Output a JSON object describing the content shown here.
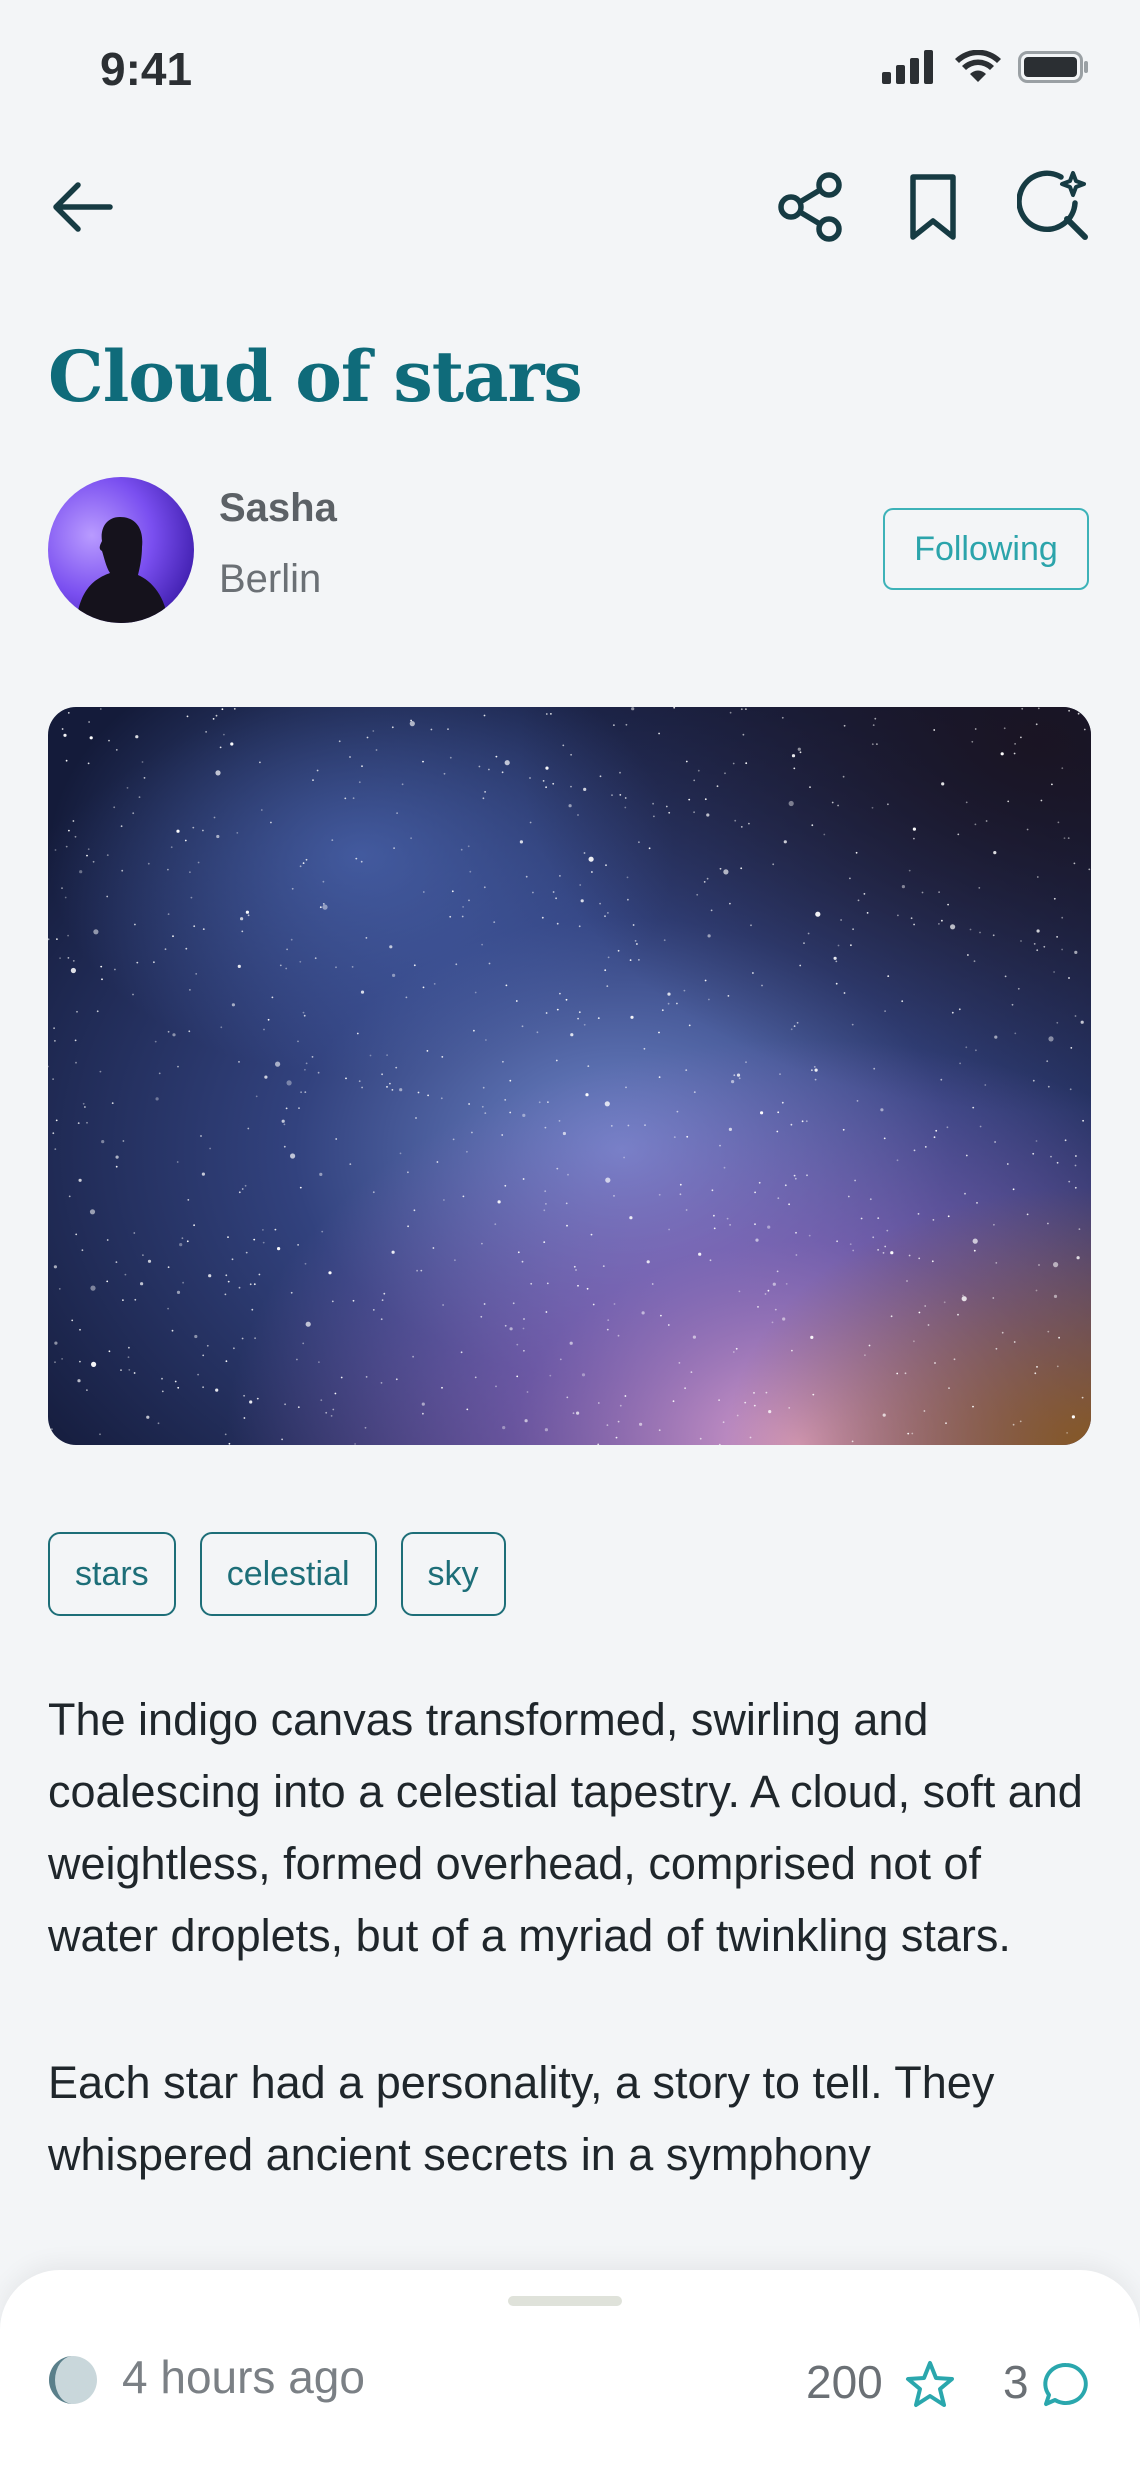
{
  "status_bar": {
    "time": "9:41"
  },
  "header": {
    "back": "arrow-left-icon",
    "share": "share-icon",
    "bookmark": "bookmark-icon",
    "search": "sparkle-search-icon"
  },
  "post": {
    "title": "Cloud of stars",
    "author": {
      "name": "Sasha",
      "location": "Berlin"
    },
    "follow_label": "Following",
    "tags": [
      "stars",
      "celestial",
      "sky"
    ],
    "paragraphs": [
      "The indigo canvas transformed, swirling and coalescing into a celestial tapestry. A cloud, soft and weightless, formed overhead, comprised not of water droplets, but of a myriad of twinkling stars.",
      "Each star had a personality, a story to tell. They whispered ancient secrets in a symphony"
    ]
  },
  "footer": {
    "time_ago": "4 hours ago",
    "likes": "200",
    "comments": "3"
  },
  "colors": {
    "accent": "#0f6b7a",
    "teal": "#3db2b8",
    "background": "#f3f5f7"
  }
}
